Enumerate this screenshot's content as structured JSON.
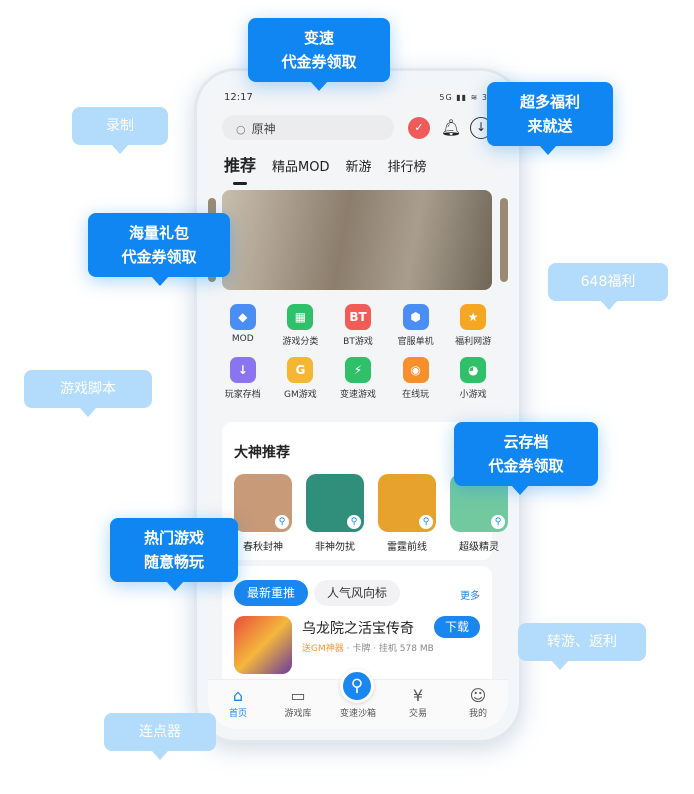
{
  "status": {
    "time": "12:17",
    "icons": "5G ▮▮ ≋ 34"
  },
  "search": {
    "placeholder": "原神"
  },
  "header_icons": [
    "sign-in-icon",
    "bell-icon",
    "download-icon"
  ],
  "tabs": [
    "推荐",
    "精品MOD",
    "新游",
    "排行榜"
  ],
  "grid": [
    {
      "label": "MOD",
      "color": "#4a8df5",
      "glyph": "◆"
    },
    {
      "label": "游戏分类",
      "color": "#2fc06a",
      "glyph": "▦"
    },
    {
      "label": "BT游戏",
      "color": "#f25b56",
      "glyph": "BT"
    },
    {
      "label": "官服单机",
      "color": "#4a8df5",
      "glyph": "⬢"
    },
    {
      "label": "福利网游",
      "color": "#f5a623",
      "glyph": "★"
    },
    {
      "label": "玩家存档",
      "color": "#8a74f0",
      "glyph": "↓"
    },
    {
      "label": "GM游戏",
      "color": "#f5b731",
      "glyph": "G"
    },
    {
      "label": "变速游戏",
      "color": "#2fc06a",
      "glyph": "⚡"
    },
    {
      "label": "在线玩",
      "color": "#f5902d",
      "glyph": "◉"
    },
    {
      "label": "小游戏",
      "color": "#2fc06a",
      "glyph": "◕"
    }
  ],
  "experts": {
    "title": "大神推荐",
    "games": [
      {
        "name": "春秋封神",
        "color": "#c89a77"
      },
      {
        "name": "非神勿扰",
        "color": "#2f8f7a"
      },
      {
        "name": "雷霆前线",
        "color": "#e6a22c"
      },
      {
        "name": "超级精灵",
        "color": "#72c9a0"
      }
    ]
  },
  "list": {
    "tab_active": "最新重推",
    "tab_other": "人气风向标",
    "more": "更多",
    "app": {
      "name": "乌龙院之活宝传奇",
      "tag": "送GM神器",
      "meta": " · 卡牌 · 挂机 578 MB",
      "download": "下载"
    }
  },
  "nav": [
    {
      "label": "首页",
      "icon": "home-icon"
    },
    {
      "label": "游戏库",
      "icon": "gamepad-icon"
    },
    {
      "label": "变速沙箱",
      "icon": "key-icon"
    },
    {
      "label": "交易",
      "icon": "bag-icon"
    },
    {
      "label": "我的",
      "icon": "profile-icon"
    }
  ],
  "callouts": {
    "speed": [
      "变速",
      "代金券领取"
    ],
    "record": "录制",
    "welfare": [
      "超多福利",
      "来就送"
    ],
    "gifts": [
      "海量礼包",
      "代金券领取"
    ],
    "w648": "648福利",
    "script": "游戏脚本",
    "cloud": [
      "云存档",
      "代金券领取"
    ],
    "hot": [
      "热门游戏",
      "随意畅玩"
    ],
    "transfer": "转游、返利",
    "clicker": "连点器"
  },
  "colors": {
    "accent": "#0f86f2",
    "light_bubble": "#b3dbfb"
  }
}
